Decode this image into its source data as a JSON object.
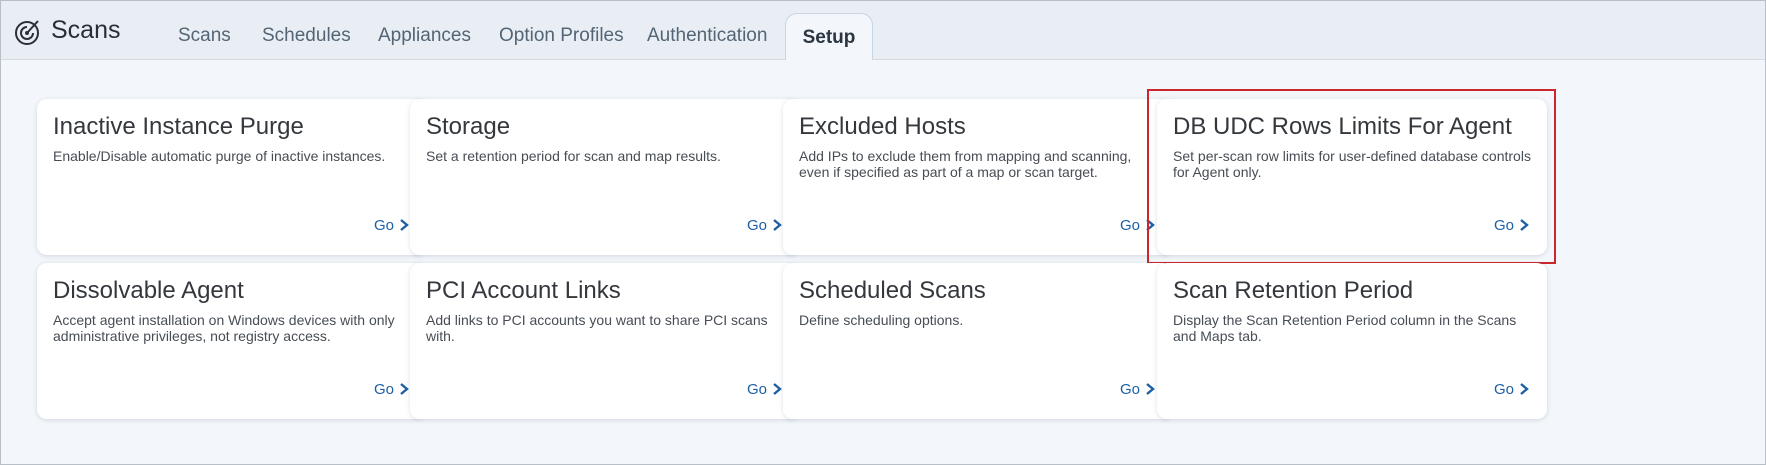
{
  "app": {
    "title": "Scans",
    "icon": "scan-radar-icon"
  },
  "tabs": [
    {
      "label": "Scans",
      "active": false
    },
    {
      "label": "Schedules",
      "active": false
    },
    {
      "label": "Appliances",
      "active": false
    },
    {
      "label": "Option Profiles",
      "active": false
    },
    {
      "label": "Authentication",
      "active": false
    },
    {
      "label": "Setup",
      "active": true
    }
  ],
  "cards": [
    {
      "title": "Inactive Instance Purge",
      "description": "Enable/Disable automatic purge of inactive instances.",
      "link": "Go"
    },
    {
      "title": "Storage",
      "description": "Set a retention period for scan and map results.",
      "link": "Go"
    },
    {
      "title": "Excluded Hosts",
      "description": "Add IPs to exclude them from mapping and scanning, even if specified as part of a map or scan target.",
      "link": "Go"
    },
    {
      "title": "DB UDC Rows Limits For Agent",
      "description": "Set per-scan row limits for user-defined database controls for Agent only.",
      "link": "Go",
      "highlighted": true
    },
    {
      "title": "Dissolvable Agent",
      "description": "Accept agent installation on Windows devices with only administrative privileges, not registry access.",
      "link": "Go"
    },
    {
      "title": "PCI Account Links",
      "description": "Add links to PCI accounts you want to share PCI scans with.",
      "link": "Go"
    },
    {
      "title": "Scheduled Scans",
      "description": "Define scheduling options.",
      "link": "Go"
    },
    {
      "title": "Scan Retention Period",
      "description": "Display the Scan Retention Period column in the Scans and Maps tab.",
      "link": "Go"
    }
  ],
  "colors": {
    "link": "#1d5fa3",
    "highlight_border": "#c9272b",
    "header_bg": "#e9eef4",
    "page_bg": "#f3f6fa"
  }
}
